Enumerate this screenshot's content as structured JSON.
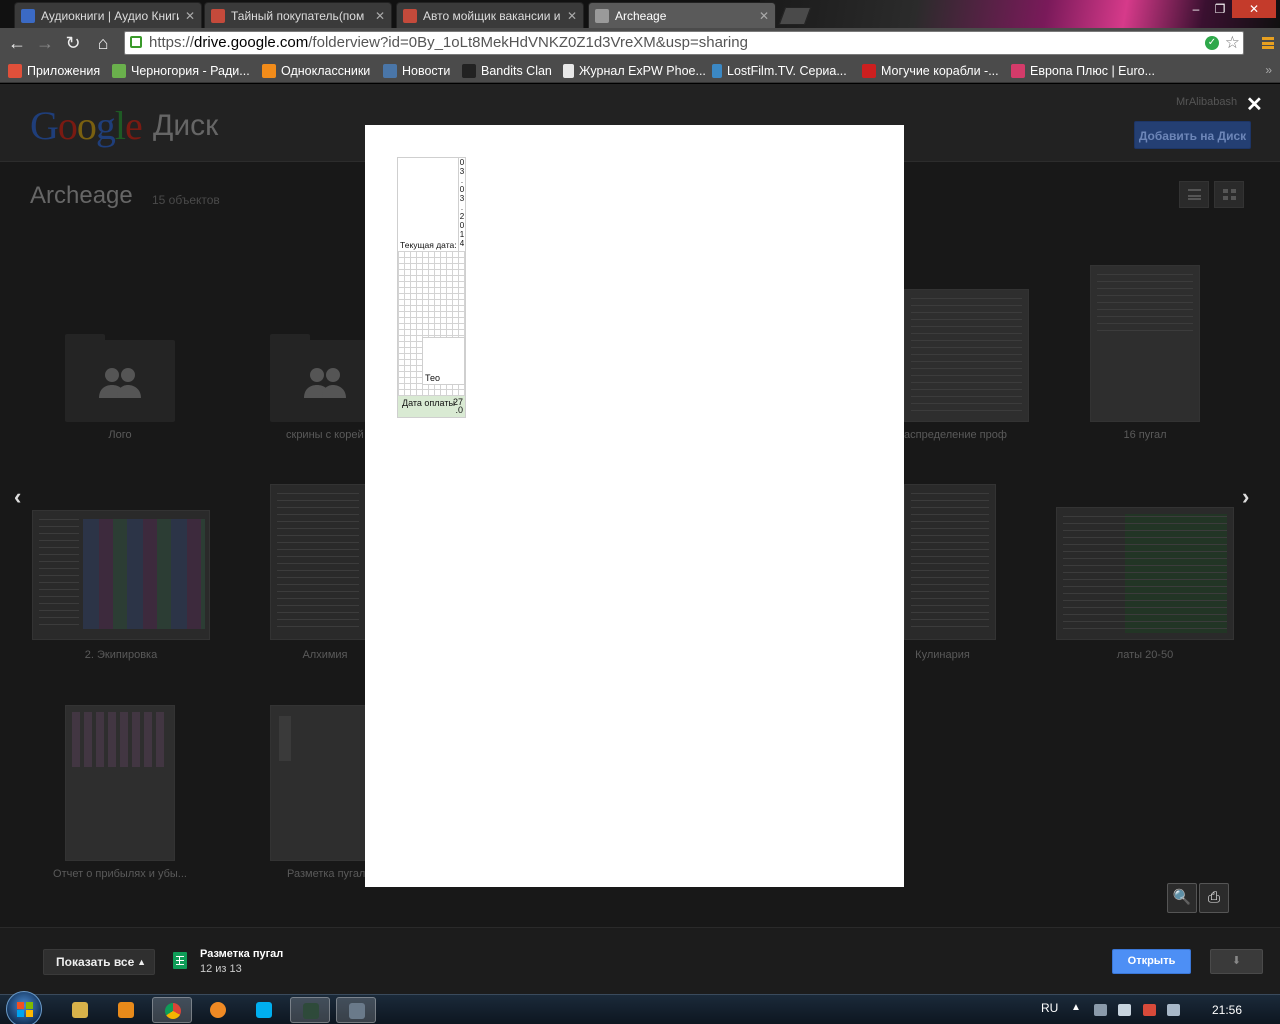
{
  "browser": {
    "tabs": [
      {
        "title": "Аудиокниги | Аудио Книги",
        "favicon_color": "#3b6ac4"
      },
      {
        "title": "Тайный покупатель(пом",
        "favicon_color": "#c44a3b"
      },
      {
        "title": "Авто мойщик вакансии и",
        "favicon_color": "#c44a3b"
      },
      {
        "title": "Archeage",
        "favicon_color": "#9a9a9a"
      }
    ],
    "window_controls": {
      "minimize": "–",
      "maximize": "❐",
      "close": "✕"
    },
    "nav": {
      "back": "←",
      "forward": "→",
      "reload": "↻",
      "home": "⌂"
    },
    "url_scheme": "https://",
    "url_domain": "drive.google.com",
    "url_path": "/folderview?id=0By_1oLt8MekHdVNKZ0Z1d3VreXM&usp=sharing",
    "bookmarks": [
      {
        "label": "Приложения",
        "icon_color": "#e0503a"
      },
      {
        "label": "Черногория - Ради...",
        "icon_color": "#6ab04c"
      },
      {
        "label": "Одноклассники",
        "icon_color": "#f28c1a"
      },
      {
        "label": "Новости",
        "icon_color": "#4a76a8"
      },
      {
        "label": "Bandits Clan",
        "icon_color": "#222222"
      },
      {
        "label": "Журнал ExPW Phoe...",
        "icon_color": "#e8e8e8"
      },
      {
        "label": "LostFilm.TV. Сериа...",
        "icon_color": "#3b88c4"
      },
      {
        "label": "Могучие корабли -...",
        "icon_color": "#cc1f1f"
      },
      {
        "label": "Европа Плюс | Euro...",
        "icon_color": "#d43b6a"
      }
    ],
    "bookmarks_more": "»"
  },
  "drive": {
    "logo_text": "Google",
    "logo_product": "Диск",
    "user": "MrAlibabash",
    "add_to_drive": "Добавить на Диск",
    "folder_title": "Archeage",
    "item_count": "15 объектов",
    "tiles": [
      {
        "label": "Лого"
      },
      {
        "label": "скрины с корей"
      },
      {
        "label": "аспределение проф"
      },
      {
        "label": "16 пугал"
      },
      {
        "label": "2. Экипировка"
      },
      {
        "label": "Алхимия"
      },
      {
        "label": "Кулинария"
      },
      {
        "label": "латы 20-50"
      },
      {
        "label": "Отчет о прибылях и убы..."
      },
      {
        "label": "Разметка пугал"
      }
    ]
  },
  "preview": {
    "current_date_label": "Текущая дата:",
    "current_date_value": "0\n3\n.\n0\n3\n.\n2\n0\n1\n4",
    "name_cell": "Тео",
    "payment_label": "Дата оплаты",
    "payment_value": "27\n.0",
    "close": "✕",
    "prev": "‹",
    "next": "›",
    "zoom": "🔍",
    "print": "⎙"
  },
  "download_bar": {
    "show_all": "Показать все",
    "file_name": "Разметка пугал",
    "file_count": "12 из 13",
    "open": "Открыть",
    "download": "⬇"
  },
  "taskbar": {
    "language": "RU",
    "time": "21:56"
  },
  "colors": {
    "open_button": "#4d8ff5",
    "sheet_payment_row": "#d9ead3",
    "sheet_icon": "#0f9d58"
  }
}
